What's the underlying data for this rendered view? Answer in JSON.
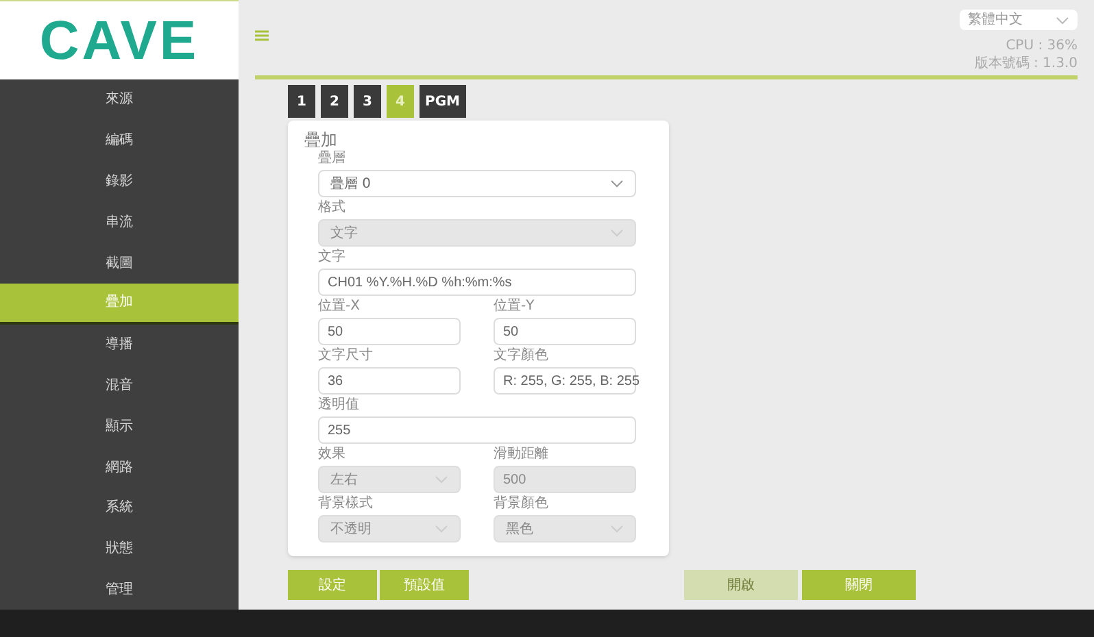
{
  "logo": "CAVE",
  "header": {
    "language": "繁體中文",
    "cpu": "CPU : 36%",
    "version": "版本號碼 : 1.3.0"
  },
  "sidebar": {
    "items": [
      {
        "label": "來源",
        "selected": false
      },
      {
        "label": "編碼",
        "selected": false
      },
      {
        "label": "錄影",
        "selected": false
      },
      {
        "label": "串流",
        "selected": false
      },
      {
        "label": "截圖",
        "selected": false
      },
      {
        "label": "疊加",
        "selected": true
      },
      {
        "label": "導播",
        "selected": false
      },
      {
        "label": "混音",
        "selected": false
      },
      {
        "label": "顯示",
        "selected": false
      },
      {
        "label": "網路",
        "selected": false
      },
      {
        "label": "系統",
        "selected": false
      },
      {
        "label": "狀態",
        "selected": false
      },
      {
        "label": "管理",
        "selected": false
      }
    ]
  },
  "tabs": [
    {
      "label": "1",
      "selected": false
    },
    {
      "label": "2",
      "selected": false
    },
    {
      "label": "3",
      "selected": false
    },
    {
      "label": "4",
      "selected": true
    },
    {
      "label": "PGM",
      "selected": false
    }
  ],
  "panel": {
    "title": "疊加",
    "rows": [
      [
        {
          "label": "疊層",
          "kind": "select",
          "value": "疊層 0",
          "disabled": false
        }
      ],
      [
        {
          "label": "格式",
          "kind": "select",
          "value": "文字",
          "disabled": true
        }
      ],
      [
        {
          "label": "文字",
          "kind": "input",
          "value": "CH01 %Y.%H.%D %h:%m:%s",
          "disabled": false
        }
      ],
      [
        {
          "label": "位置-X",
          "kind": "input",
          "value": "50",
          "disabled": false
        },
        {
          "label": "位置-Y",
          "kind": "input",
          "value": "50",
          "disabled": false
        }
      ],
      [
        {
          "label": "文字尺寸",
          "kind": "input",
          "value": "36",
          "disabled": false
        },
        {
          "label": "文字顏色",
          "kind": "input",
          "value": "R: 255, G: 255, B: 255",
          "disabled": false
        }
      ],
      [
        {
          "label": "透明值",
          "kind": "input",
          "value": "255",
          "disabled": false
        }
      ],
      [
        {
          "label": "效果",
          "kind": "select",
          "value": "左右",
          "disabled": true
        },
        {
          "label": "滑動距離",
          "kind": "input",
          "value": "500",
          "disabled": true
        }
      ],
      [
        {
          "label": "背景樣式",
          "kind": "select",
          "value": "不透明",
          "disabled": true
        },
        {
          "label": "背景顏色",
          "kind": "select",
          "value": "黑色",
          "disabled": true
        }
      ]
    ]
  },
  "buttons_left": [
    {
      "label": "設定",
      "disabled": false
    },
    {
      "label": "預設值",
      "disabled": false
    }
  ],
  "buttons_right": [
    {
      "label": "開啟",
      "disabled": true
    },
    {
      "label": "關閉",
      "disabled": false
    }
  ]
}
